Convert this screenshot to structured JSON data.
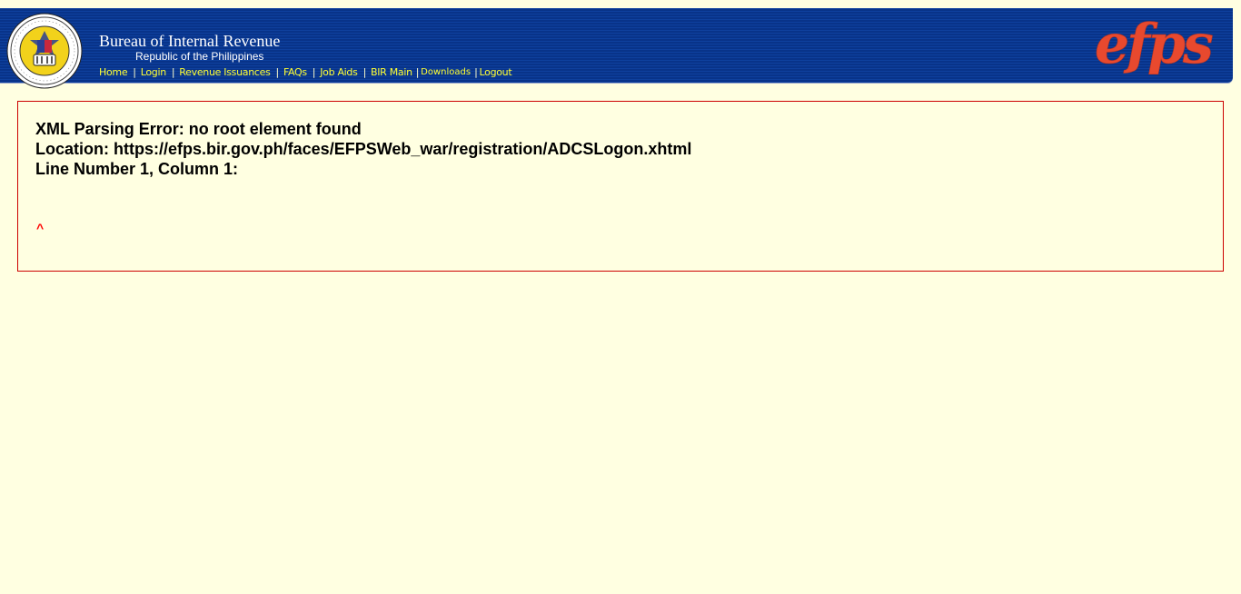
{
  "header": {
    "org_title": "Bureau of Internal Revenue",
    "org_subtitle": "Republic of the Philippines",
    "logo_text": "efps",
    "nav": [
      {
        "label": "Home"
      },
      {
        "label": "Login"
      },
      {
        "label": "Revenue Issuances"
      },
      {
        "label": "FAQs"
      },
      {
        "label": "Job Aids"
      },
      {
        "label": "BIR Main"
      },
      {
        "label": "Downloads"
      },
      {
        "label": "Logout"
      }
    ],
    "separator": "|",
    "colors": {
      "bar": "#0b3a97",
      "nav_text": "#ffff33",
      "logo": "#e8492e"
    },
    "seal_icon": "bir-seal-icon"
  },
  "error": {
    "line1": "XML Parsing Error: no root element found",
    "line2": "Location: https://efps.bir.gov.ph/faces/EFPSWeb_war/registration/ADCSLogon.xhtml",
    "line3": "Line Number 1, Column 1:",
    "caret": "^",
    "colors": {
      "border": "#cc0000",
      "background": "#ffffe1",
      "caret": "#ff0000"
    }
  }
}
